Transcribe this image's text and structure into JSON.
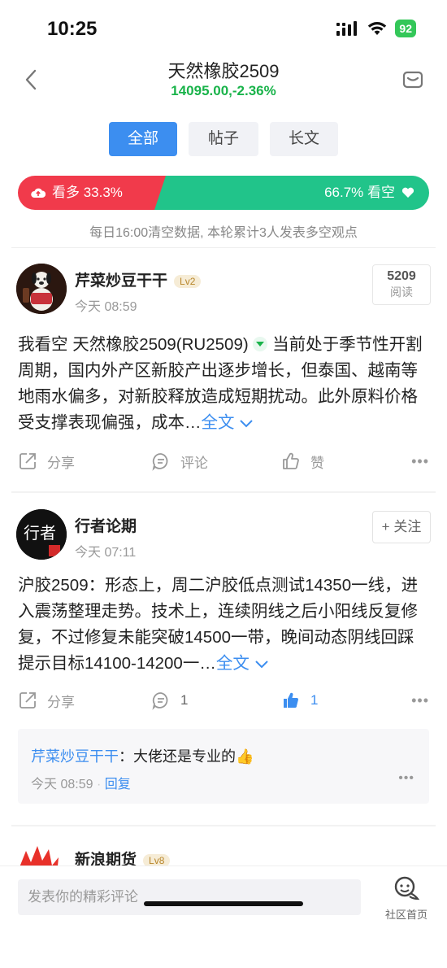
{
  "status": {
    "time": "10:25",
    "battery": "92"
  },
  "header": {
    "title": "天然橡胶2509",
    "subtitle": "14095.00,-2.36%"
  },
  "tabs": [
    {
      "label": "全部",
      "active": true
    },
    {
      "label": "帖子",
      "active": false
    },
    {
      "label": "长文",
      "active": false
    }
  ],
  "sentiment": {
    "bull_label": "看多 33.3%",
    "bear_label": "66.7% 看空",
    "bull_percent": 33.3,
    "bear_percent": 66.7,
    "note": "每日16:00清空数据, 本轮累计3人发表多空观点"
  },
  "posts": [
    {
      "author": "芹菜炒豆干干",
      "level": "Lv2",
      "time": "今天 08:59",
      "reads": "5209",
      "reads_label": "阅读",
      "body_prefix": "我看空 天然橡胶2509(RU2509)",
      "body": " 当前处于季节性开割周期，国内外产区新胶产出逐步增长，但泰国、越南等地雨水偏多，对新胶释放造成短期扰动。此外原料价格受支撑表现偏强，成本…",
      "more": "全文",
      "share": "分享",
      "comment": "评论",
      "like": "赞"
    },
    {
      "author": "行者论期",
      "time": "今天 07:11",
      "follow": "+ 关注",
      "body": "沪胶2509：形态上，周二沪胶低点测试14350一线，进入震荡整理走势。技术上，连续阴线之后小阳线反复修复，不过修复未能突破14500一带，晚间动态阴线回踩提示目标14100-14200一…",
      "more": "全文",
      "share": "分享",
      "comment": "1",
      "like": "1",
      "reply": {
        "author": "芹菜炒豆干干",
        "text": "：大佬还是专业的👍",
        "time": "今天 08:59",
        "action": "回复"
      }
    },
    {
      "author": "新浪期货",
      "level": "Lv8"
    }
  ],
  "bottom": {
    "comment_placeholder": "发表你的精彩评论",
    "community_label": "社区首页"
  },
  "colors": {
    "accent": "#3c8ef0",
    "bull": "#f13a4b",
    "bear": "#21c48a",
    "down": "#19b34a"
  }
}
